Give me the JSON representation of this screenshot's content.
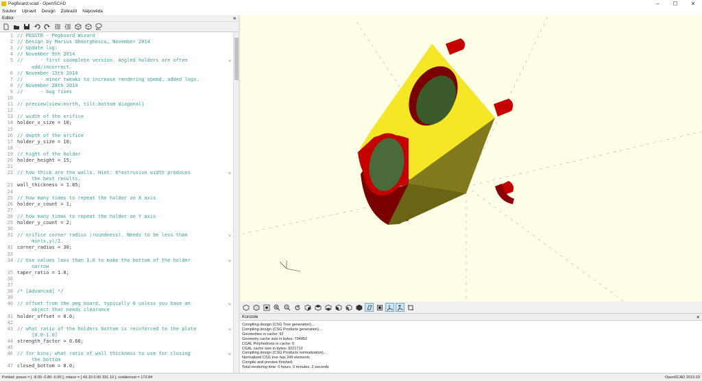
{
  "window": {
    "title": "PegBoard.scad - OpenSCAD",
    "min": "–",
    "max": "☐",
    "close": "✕"
  },
  "menu": [
    "Soubor",
    "Upravit",
    "Design",
    "Zobrazit",
    "Nápověda"
  ],
  "editor": {
    "header": "Editor",
    "close": "✕",
    "toolbar_icons": [
      "new-file-icon",
      "open-file-icon",
      "save-icon",
      "undo-icon",
      "redo-icon",
      "unindent-icon",
      "indent-icon",
      "preview-icon",
      "render-icon",
      "export-stl-icon"
    ],
    "stl_label": "STL",
    "lines": [
      {
        "n": "1",
        "t": "// PEGSTR - Pegboard Wizard",
        "k": "comment"
      },
      {
        "n": "2",
        "t": "// Design by Marius Gheorghescu, November 2014",
        "k": "comment"
      },
      {
        "n": "3",
        "t": "// Update log:",
        "k": "comment"
      },
      {
        "n": "4",
        "t": "// November 9th 2014",
        "k": "comment"
      },
      {
        "n": "5",
        "t": "//      - first coomplete version. Angled holders are often",
        "k": "comment",
        "wrap": true
      },
      {
        "n": "",
        "t": "     odd/incorrect.",
        "k": "comment"
      },
      {
        "n": "6",
        "t": "// November 15th 2014",
        "k": "comment"
      },
      {
        "n": "7",
        "t": "//      - minor tweaks to increase rendering speed. added logo.",
        "k": "comment"
      },
      {
        "n": "8",
        "t": "// November 28th 2014",
        "k": "comment"
      },
      {
        "n": "9",
        "t": "//      - bug fixes",
        "k": "comment"
      },
      {
        "n": "10",
        "t": "",
        "k": "code"
      },
      {
        "n": "11",
        "t": "// preview[view:north, tilt:bottom diagonal]",
        "k": "comment"
      },
      {
        "n": "12",
        "t": "",
        "k": "code"
      },
      {
        "n": "13",
        "t": "// width of the orifice",
        "k": "comment"
      },
      {
        "n": "14",
        "t": "holder_x_size = 10;",
        "k": "code"
      },
      {
        "n": "15",
        "t": "",
        "k": "code"
      },
      {
        "n": "16",
        "t": "// depth of the orifice",
        "k": "comment"
      },
      {
        "n": "17",
        "t": "holder_y_size = 10;",
        "k": "code"
      },
      {
        "n": "18",
        "t": "",
        "k": "code"
      },
      {
        "n": "19",
        "t": "// hight of the holder",
        "k": "comment"
      },
      {
        "n": "20",
        "t": "holder_height = 15;",
        "k": "code"
      },
      {
        "n": "21",
        "t": "",
        "k": "code"
      },
      {
        "n": "22",
        "t": "// how thick are the walls. Hint: 6*extrusion width produces",
        "k": "comment",
        "wrap": true
      },
      {
        "n": "",
        "t": "     the best results.",
        "k": "comment"
      },
      {
        "n": "23",
        "t": "wall_thickness = 1.85;",
        "k": "code"
      },
      {
        "n": "24",
        "t": "",
        "k": "code"
      },
      {
        "n": "25",
        "t": "// how many times to repeat the holder on X axis",
        "k": "comment"
      },
      {
        "n": "26",
        "t": "holder_x_count = 1;",
        "k": "code"
      },
      {
        "n": "27",
        "t": "",
        "k": "code"
      },
      {
        "n": "28",
        "t": "// how many times to repeat the holder on Y axis",
        "k": "comment"
      },
      {
        "n": "29",
        "t": "holder_y_count = 2;",
        "k": "code"
      },
      {
        "n": "30",
        "t": "",
        "k": "code"
      },
      {
        "n": "31",
        "t": "// orifice corner radius (roundness). Needs to be less than",
        "k": "comment",
        "wrap": true
      },
      {
        "n": "",
        "t": "     min(x,y)/2.",
        "k": "comment"
      },
      {
        "n": "32",
        "t": "corner_radius = 30;",
        "k": "code"
      },
      {
        "n": "33",
        "t": "",
        "k": "code"
      },
      {
        "n": "34",
        "t": "// Use values less than 1.0 to make the bottom of the holder",
        "k": "comment",
        "wrap": true
      },
      {
        "n": "",
        "t": "     narrow",
        "k": "comment"
      },
      {
        "n": "35",
        "t": "taper_ratio = 1.0;",
        "k": "code"
      },
      {
        "n": "36",
        "t": "",
        "k": "code"
      },
      {
        "n": "37",
        "t": "",
        "k": "code"
      },
      {
        "n": "38",
        "t": "/* [Advanced] */",
        "k": "comment"
      },
      {
        "n": "39",
        "t": "",
        "k": "code"
      },
      {
        "n": "40",
        "t": "// offset from the peg board, typically 0 unless you have an",
        "k": "comment",
        "wrap": true
      },
      {
        "n": "",
        "t": "     object that needs clearance",
        "k": "comment"
      },
      {
        "n": "41",
        "t": "holder_offset = 0.0;",
        "k": "code"
      },
      {
        "n": "42",
        "t": "",
        "k": "code"
      },
      {
        "n": "43",
        "t": "// what ratio of the holders bottom is reinforced to the plate",
        "k": "comment",
        "wrap": true
      },
      {
        "n": "",
        "t": "     [0.0-1.0]",
        "k": "comment"
      },
      {
        "n": "44",
        "t": "strength_factor = 0.66;",
        "k": "code"
      },
      {
        "n": "45",
        "t": "",
        "k": "code"
      },
      {
        "n": "46",
        "t": "// for bins: what ratio of wall thickness to use for closing",
        "k": "comment",
        "wrap": true
      },
      {
        "n": "",
        "t": "     the bottom",
        "k": "comment"
      },
      {
        "n": "47",
        "t": "closed_bottom = 0.0;",
        "k": "code"
      }
    ]
  },
  "viewport": {
    "toolbar_icons": [
      "preview-icon",
      "render-icon",
      "view-all-icon",
      "zoom-in-icon",
      "zoom-out-icon",
      "reset-view-icon",
      "view-right-icon",
      "view-top-icon",
      "view-bottom-icon",
      "view-left-icon",
      "view-front-icon",
      "view-back-icon",
      "perspective-icon",
      "orthogonal-icon",
      "show-axes-icon",
      "show-scale-icon",
      "show-edges-icon"
    ],
    "colors": {
      "yellow": "#f5e626",
      "olive": "#827b1d",
      "red": "#c40000",
      "darkred": "#7a0000"
    }
  },
  "console": {
    "header": "Konzole",
    "close": "✕",
    "lines": [
      "Compiling design (CSG Tree generation)...",
      "Compiling design (CSG Products generation)...",
      "Geometries in cache: 92",
      "Geometry cache size in bytes: 794952",
      "CGAL Polyhedrons in cache: 0",
      "CGAL cache size in bytes: 3221712",
      "Compiling design (CSG Products normalization)...",
      "Normalized CSG tree has 249 elements",
      "Compile and preview finished.",
      "Total rendering time: 0 hours, 0 minutes, 2 seconds"
    ]
  },
  "status": {
    "text": "Pohled: posun = [ -8.00 -0.80 -0.00 ], rotace = [ 43.10 0.00 331.10 ], vzdálenost = 172.84",
    "version": "OpenSCAD 2015.03"
  }
}
